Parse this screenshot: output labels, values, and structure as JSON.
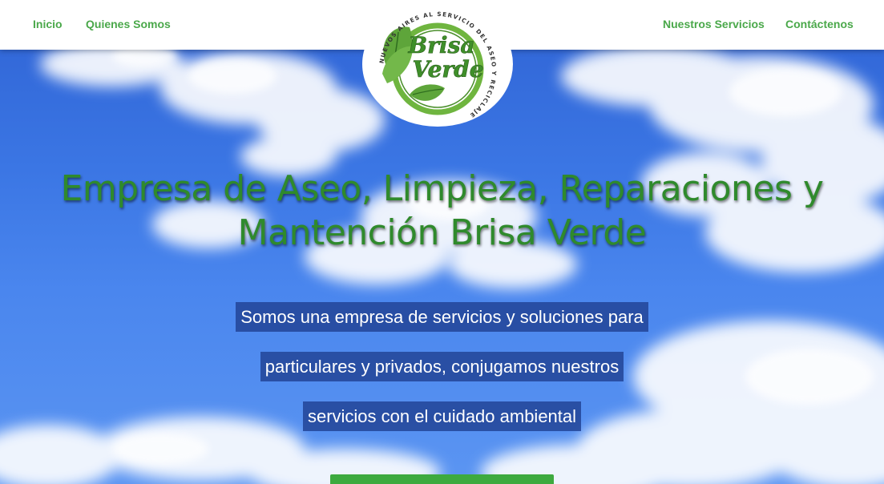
{
  "nav": {
    "left": [
      {
        "label": "Inicio"
      },
      {
        "label": "Quienes Somos"
      }
    ],
    "right": [
      {
        "label": "Nuestros Servicios"
      },
      {
        "label": "Contáctenos"
      }
    ]
  },
  "logo": {
    "brand_line1": "Brisa",
    "brand_line2": "Verde",
    "ring_text": "NUEVOS AIRES AL SERVICIO DEL ASEO Y RECICLAJE"
  },
  "hero": {
    "title_line1": "Empresa de Aseo, Limpieza, Reparaciones y",
    "title_line2": "Mantención Brisa Verde",
    "tagline": [
      "Somos una empresa de servicios y soluciones para",
      "particulares y privados, conjugamos nuestros",
      "servicios con el cuidado ambiental"
    ]
  },
  "colors": {
    "nav_text": "#4aa84a",
    "title_green": "#2f8a2c",
    "tag_bg": "#224496",
    "cta_green": "#3daa3f",
    "sky": "#3b76e4"
  }
}
